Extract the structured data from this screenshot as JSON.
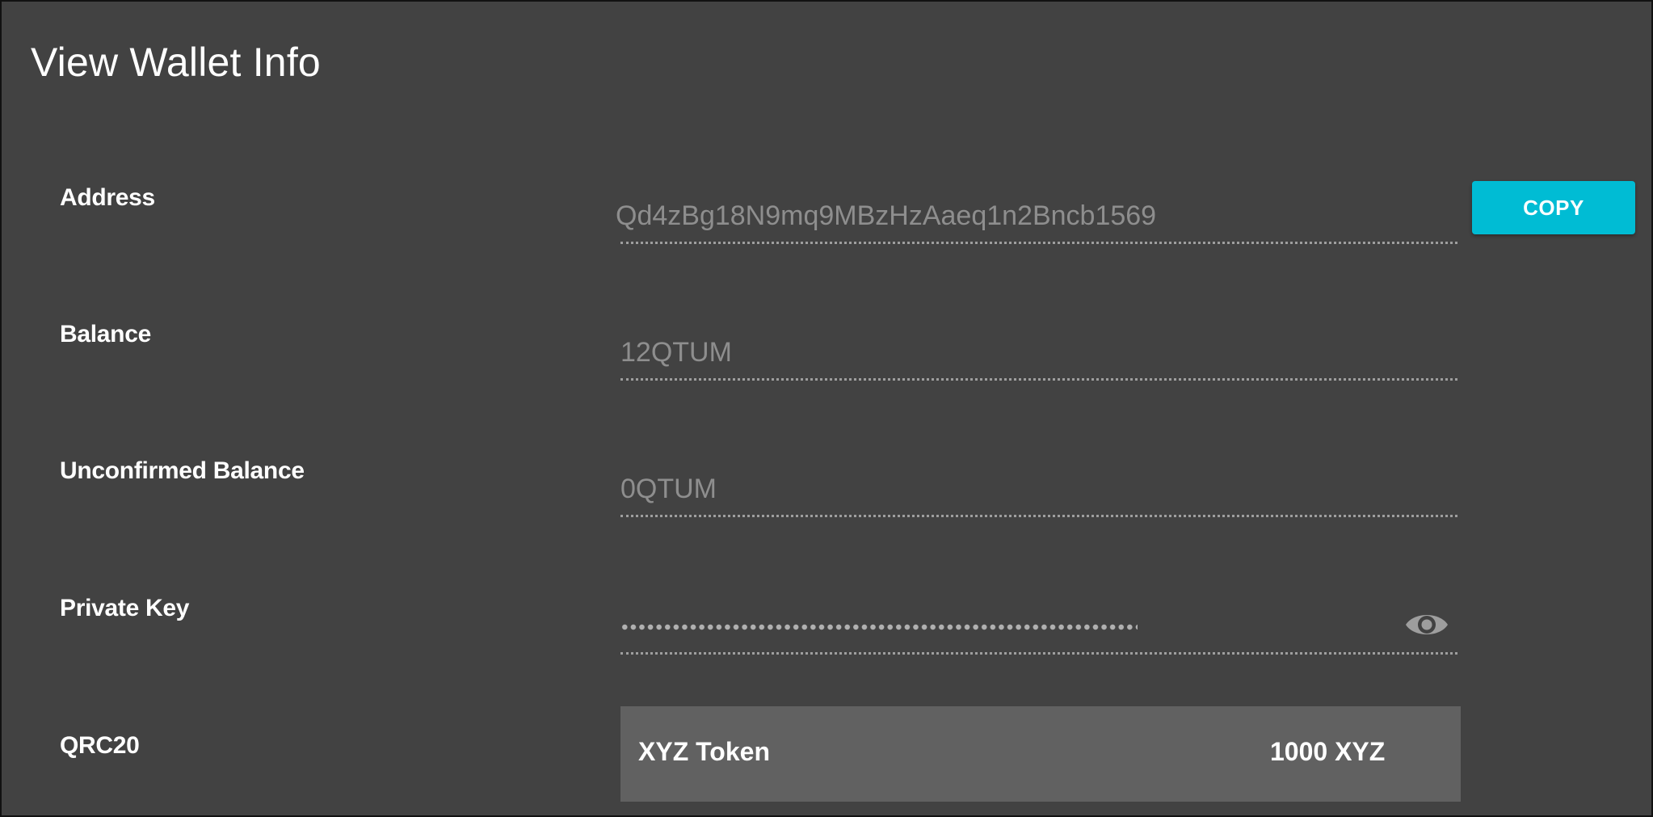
{
  "page": {
    "title": "View Wallet Info"
  },
  "fields": {
    "address": {
      "label": "Address",
      "value": "Qd4zBg18N9mq9MBzHzAaeq1n2Bncb1569",
      "copy_label": "COPY"
    },
    "balance": {
      "label": "Balance",
      "value": "12QTUM"
    },
    "unconfirmed_balance": {
      "label": "Unconfirmed Balance",
      "value": "0QTUM"
    },
    "private_key": {
      "label": "Private Key",
      "masked": true,
      "toggle_icon": "eye-icon"
    },
    "qrc20": {
      "label": "QRC20",
      "tokens": [
        {
          "name": "XYZ Token",
          "amount": "1000 XYZ"
        }
      ]
    }
  },
  "colors": {
    "background": "#424242",
    "accent": "#00bcd4",
    "token_row": "#616161",
    "muted_text": "#8e8e8e"
  }
}
